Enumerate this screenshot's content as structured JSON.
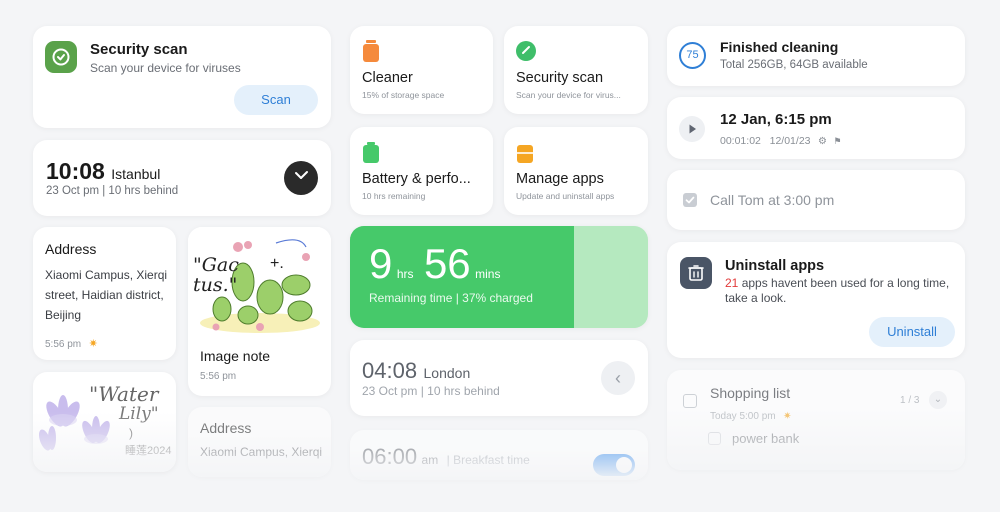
{
  "colors": {
    "security_green": "#5aa24a",
    "battery_green": "#46c96a",
    "cleaner_orange": "#f58a3c",
    "manage_orange": "#f5a623",
    "accent_blue": "#2f7fd6",
    "button_bg": "#e4f0fb",
    "badge_red": "#e23a3a",
    "slate_icon": "#4a5566"
  },
  "security_card": {
    "icon": "shield-check-icon",
    "title": "Security scan",
    "subtitle": "Scan your device for viruses",
    "button": "Scan"
  },
  "clock_istanbul": {
    "time": "10:08",
    "city": "Istanbul",
    "detail": "23 Oct pm | 10 hrs behind",
    "icon": "analog-clock-icon"
  },
  "address_card": {
    "heading": "Address",
    "body": "Xiaomi Campus, Xierqi street, Haidian district, Beijing",
    "time": "5:56 pm"
  },
  "water_lily_note": {
    "lines": [
      "\"Water",
      "Lily\"",
      ")",
      "睡莲2024"
    ]
  },
  "image_note": {
    "sketch_text": "\"Gac tus.\"",
    "sketch_mark": "+.",
    "title": "Image note",
    "time": "5:56 pm"
  },
  "address_card_2": {
    "heading": "Address",
    "body": "Xiaomi Campus, Xierqi"
  },
  "cleaner_tile": {
    "icon": "trash-icon",
    "title": "Cleaner",
    "subtitle": "15% of storage space"
  },
  "security_tile": {
    "icon": "shield-check-icon",
    "title": "Security scan",
    "subtitle": "Scan your device for virus..."
  },
  "battery_tile": {
    "icon": "battery-icon",
    "title": "Battery & perfo...",
    "subtitle": "10 hrs remaining"
  },
  "manage_tile": {
    "icon": "app-box-icon",
    "title": "Manage apps",
    "subtitle": "Update and uninstall apps"
  },
  "battery_widget": {
    "hours": "9",
    "hours_unit": "hrs",
    "minutes": "56",
    "minutes_unit": "mins",
    "caption": "Remaining time | 37% charged",
    "charge_fraction": 0.37
  },
  "clock_london": {
    "time": "04:08",
    "city": "London",
    "detail": "23 Oct pm | 10 hrs behind",
    "icon": "chevron-left-icon"
  },
  "alarm_card": {
    "time": "06:00",
    "ampm": "am",
    "label": "| Breakfast time"
  },
  "cleaning_card": {
    "score": "75",
    "title": "Finished cleaning",
    "subtitle": "Total 256GB, 64GB available"
  },
  "recording_card": {
    "icon": "play-icon",
    "title": "12 Jan, 6:15 pm",
    "meta": "00:01:02   12/01/23"
  },
  "todo_card": {
    "text": "Call Tom at 3:00 pm",
    "icon": "checkbox-checked-icon"
  },
  "uninstall_card": {
    "icon": "trash-bin-icon",
    "title": "Uninstall apps",
    "count": "21",
    "text_after_count": " apps havent been used for a long time, take a look.",
    "button": "Uninstall"
  },
  "shopping_card": {
    "title": "Shopping list",
    "meta": "Today 5:00 pm",
    "counter": "1 / 3",
    "item": "power bank"
  }
}
